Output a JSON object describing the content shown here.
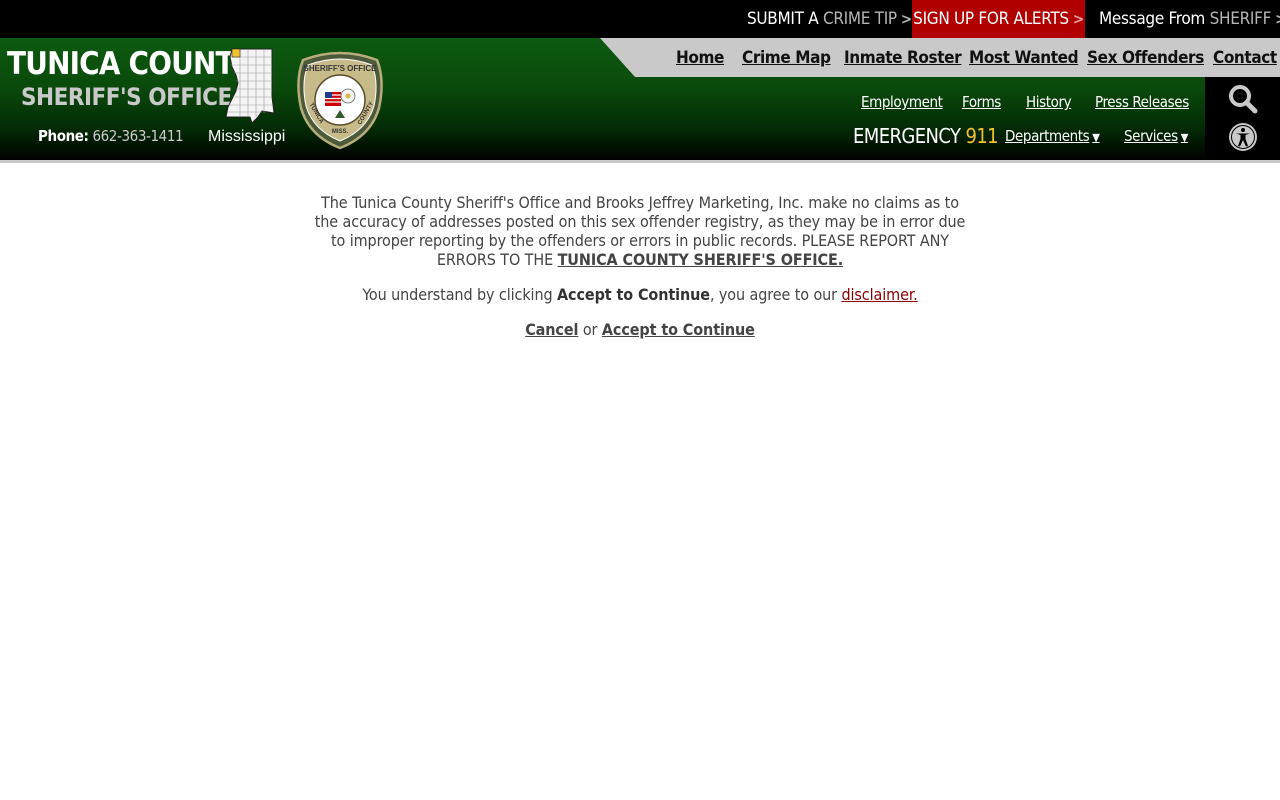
{
  "topbar": {
    "crime_tip_a": "SUBMIT A",
    "crime_tip_b": "CRIME TIP",
    "alerts": "SIGN UP FOR ALERTS",
    "sheriff_a": "Message From",
    "sheriff_b": "SHERIFF",
    "chevron": ">"
  },
  "brand": {
    "title": "TUNICA COUNTY",
    "subtitle": "SHERIFF'S OFFICE",
    "phone_label": "Phone:",
    "phone_number": "662-363-1411",
    "state": "Mississippi",
    "badge_top": "SHERIFF'S OFFICE",
    "badge_left": "TUNICA",
    "badge_right": "COUNTY",
    "badge_bottom": "MISS."
  },
  "nav": {
    "main": [
      "Home",
      "Crime Map",
      "Inmate Roster",
      "Most Wanted",
      "Sex Offenders",
      "Contact"
    ],
    "secondary": [
      "Employment",
      "Forms",
      "History",
      "Press Releases"
    ],
    "emergency_label": "EMERGENCY",
    "emergency_number": "911",
    "departments": "Departments",
    "services": "Services"
  },
  "disclaimer": {
    "p1_text": "The Tunica County Sheriff's Office and Brooks Jeffrey Marketing, Inc. make no claims as to the accuracy of addresses posted on this sex offender registry, as they may be in error due to improper reporting by the offenders or errors in public records. PLEASE REPORT ANY ERRORS TO THE",
    "p1_link": "TUNICA COUNTY SHERIFF'S OFFICE.",
    "p2_pre": "You understand by clicking",
    "p2_bold": "Accept to Continue",
    "p2_mid": ", you agree to our",
    "p2_link": "disclaimer.",
    "cancel": "Cancel",
    "or": "or",
    "accept": "Accept to Continue"
  },
  "colors": {
    "alert_red": "#b00000",
    "header_green": "#0a4a0c",
    "emergency_yellow": "#f2c230",
    "link_red": "#8b0000"
  },
  "icons": {
    "search": "search-icon",
    "accessibility": "accessibility-icon",
    "chevron": "chevron-right-icon",
    "caret": "chevron-down-icon"
  }
}
